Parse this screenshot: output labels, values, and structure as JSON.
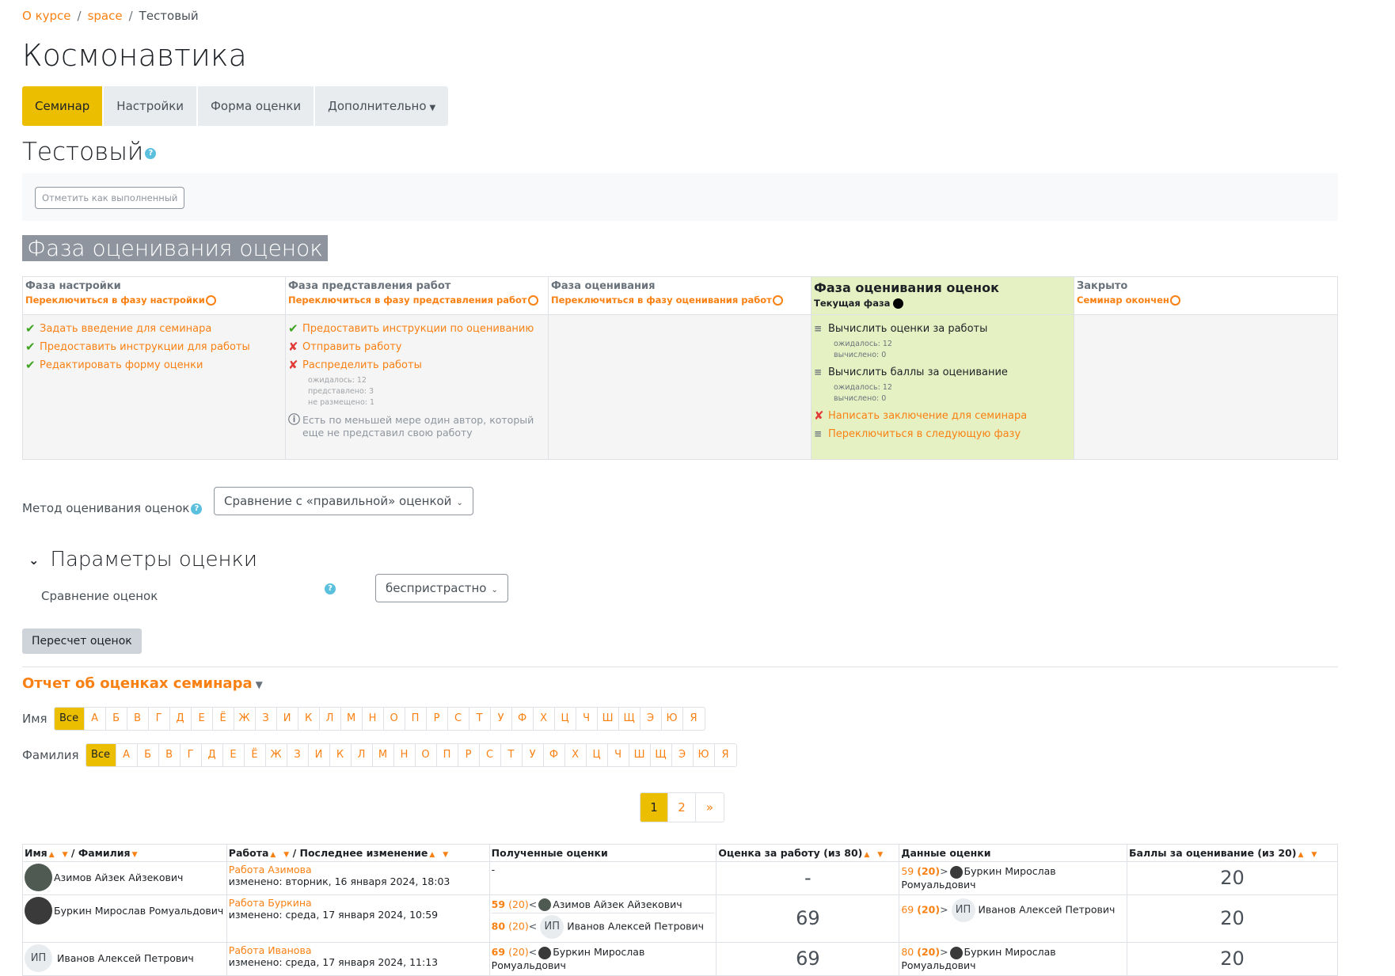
{
  "breadcrumb": {
    "items": [
      "О курсе",
      "space",
      "Тестовый"
    ]
  },
  "course_title": "Космонавтика",
  "tabs": [
    {
      "label": "Семинар"
    },
    {
      "label": "Настройки"
    },
    {
      "label": "Форма оценки"
    },
    {
      "label": "Дополнительно"
    }
  ],
  "activity_title": "Тестовый",
  "help_icon": "?",
  "mark_done": "Отметить как выполненный",
  "phase_heading": "Фаза оценивания оценок",
  "phases": {
    "setup": {
      "name": "Фаза настройки",
      "switch": "Переключиться в фазу настройки",
      "tasks": [
        "Задать введение для семинара",
        "Предоставить инструкции для работы",
        "Редактировать форму оценки"
      ]
    },
    "submission": {
      "name": "Фаза представления работ",
      "switch": "Переключиться в фазу представления работ",
      "tasks": [
        "Предоставить инструкции по оцениванию",
        "Отправить работу",
        "Распределить работы"
      ],
      "alloc_details": [
        "ожидалось: 12",
        "представлено: 3",
        "не размещено: 1"
      ],
      "info": "Есть по меньшей мере один автор, который еще не представил свою работу"
    },
    "assessment": {
      "name": "Фаза оценивания",
      "switch": "Переключиться в фазу оценивания работ"
    },
    "evaluation": {
      "name": "Фаза оценивания оценок",
      "current": "Текущая фаза",
      "task1": "Вычислить оценки за работы",
      "task1_details": [
        "ожидалось: 12",
        "вычислено: 0"
      ],
      "task2": "Вычислить баллы за оценивание",
      "task2_details": [
        "ожидалось: 12",
        "вычислено: 0"
      ],
      "task3": "Написать заключение для семинара",
      "task4": "Переключиться в следующую фазу"
    },
    "closed": {
      "name": "Закрыто",
      "switch": "Семинар окончен"
    }
  },
  "method": {
    "label": "Метод оценивания оценок",
    "value": "Сравнение с «правильной» оценкой"
  },
  "params": {
    "title": "Параметры оценки",
    "compare_label": "Сравнение оценок",
    "compare_value": "беспристрастно"
  },
  "recalc_button": "Пересчет оценок",
  "report_title": "Отчет об оценках семинара",
  "initials": {
    "first_label": "Имя",
    "last_label": "Фамилия",
    "all": "Все",
    "letters": [
      "А",
      "Б",
      "В",
      "Г",
      "Д",
      "Е",
      "Ё",
      "Ж",
      "З",
      "И",
      "К",
      "Л",
      "М",
      "Н",
      "О",
      "П",
      "Р",
      "С",
      "Т",
      "У",
      "Ф",
      "Х",
      "Ц",
      "Ч",
      "Ш",
      "Щ",
      "Э",
      "Ю",
      "Я"
    ]
  },
  "pager": [
    "1",
    "2",
    "»"
  ],
  "table": {
    "headers": {
      "first": "Имя",
      "last": "/ Фамилия",
      "work": "Работа",
      "modified": "/ Последнее изменение",
      "received": "Полученные оценки",
      "grade": "Оценка за работу (из 80)",
      "given": "Данные оценки",
      "gradinggrade": "Баллы за оценивание (из 20)"
    },
    "rows": [
      {
        "name": "Азимов Айзек Айзекович",
        "work": "Работа Азимова",
        "modified": "изменено: вторник, 16 января 2024, 18:03",
        "received": [
          {
            "text": "-"
          }
        ],
        "grade": "-",
        "given": [
          {
            "g": "59",
            "gg": "(20)",
            "arrow": ">",
            "who": "Буркин Мирослав Ромуальдович"
          }
        ],
        "gradinggrade": "20"
      },
      {
        "name": "Буркин Мирослав Ромуальдович",
        "work": "Работа Буркина",
        "modified": "изменено: среда, 17 января 2024, 10:59",
        "received": [
          {
            "g": "59",
            "gg": "(20)",
            "arrow": "<",
            "who": "Азимов Айзек Айзекович"
          },
          {
            "g": "80",
            "gg": "(20)",
            "arrow": "<",
            "who": "Иванов Алексей Петрович",
            "initials": "ИП"
          }
        ],
        "grade": "69",
        "given": [
          {
            "g": "69",
            "gg": "(20)",
            "arrow": ">",
            "who": "Иванов Алексей Петрович",
            "initials": "ИП"
          }
        ],
        "gradinggrade": "20"
      },
      {
        "name": "Иванов Алексей Петрович",
        "initials": "ИП",
        "work": "Работа Иванова",
        "modified": "изменено: среда, 17 января 2024, 11:13",
        "received": [
          {
            "g": "69",
            "gg": "(20)",
            "arrow": "<",
            "who": "Буркин Мирослав Ромуальдович"
          }
        ],
        "grade": "69",
        "given": [
          {
            "g": "80",
            "gg": "(20)",
            "arrow": ">",
            "who": "Буркин Мирослав Ромуальдович"
          }
        ],
        "gradinggrade": "20"
      }
    ]
  },
  "colors": {
    "accent": "#f98012",
    "tab_active": "#ebbe00",
    "current_phase": "#e6f1c3",
    "ok": "#3fa322",
    "fail": "#e23c39"
  }
}
